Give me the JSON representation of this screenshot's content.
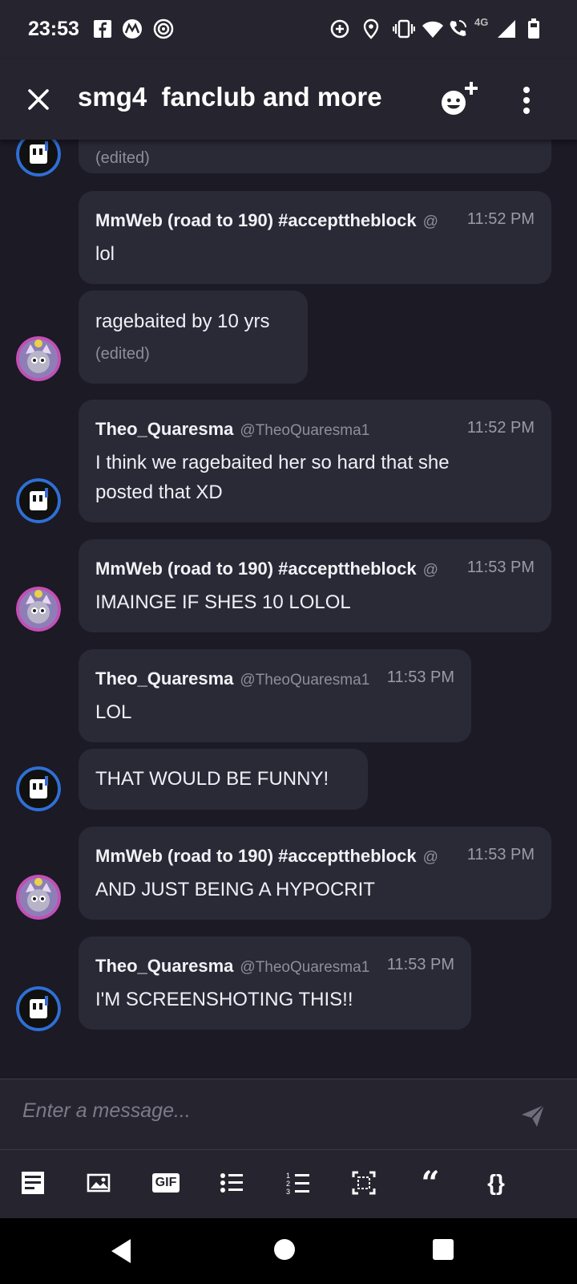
{
  "status_bar": {
    "time": "23:53",
    "network": "4G"
  },
  "header": {
    "title": "smg4  fanclub and more"
  },
  "messages": [
    {
      "edited": "(edited)"
    },
    {
      "author": "MmWeb (road to 190) #accepttheblock",
      "handle": "@",
      "time": "11:52 PM",
      "text": "lol"
    },
    {
      "text": "ragebaited by 10 yrs",
      "edited": "(edited)"
    },
    {
      "author": "Theo_Quaresma",
      "handle": "@TheoQuaresma1",
      "time": "11:52 PM",
      "text": "I think we ragebaited her so hard that she posted that XD"
    },
    {
      "author": "MmWeb (road to 190) #accepttheblock",
      "handle": "@",
      "time": "11:53 PM",
      "text": "IMAINGE IF SHES 10 LOLOL"
    },
    {
      "author": "Theo_Quaresma",
      "handle": "@TheoQuaresma1",
      "time": "11:53 PM",
      "text": "LOL"
    },
    {
      "text": "THAT WOULD BE FUNNY!"
    },
    {
      "author": "MmWeb (road to 190) #accepttheblock",
      "handle": "@",
      "time": "11:53 PM",
      "text": "AND JUST BEING A HYPOCRIT"
    },
    {
      "author": "Theo_Quaresma",
      "handle": "@TheoQuaresma1",
      "time": "11:53 PM",
      "text": "I'M SCREENSHOTING THIS!!"
    }
  ],
  "composer": {
    "placeholder": "Enter a message..."
  },
  "toolbar": {
    "gif_label": "GIF",
    "quote_label": "“",
    "code_label": "{}"
  },
  "colors": {
    "background": "#1b1a25",
    "bubble": "#2a2936",
    "bar": "#26252f",
    "avatar_ring_theo": "#2f6fd6",
    "avatar_ring_mmweb": "#c44fb6"
  }
}
